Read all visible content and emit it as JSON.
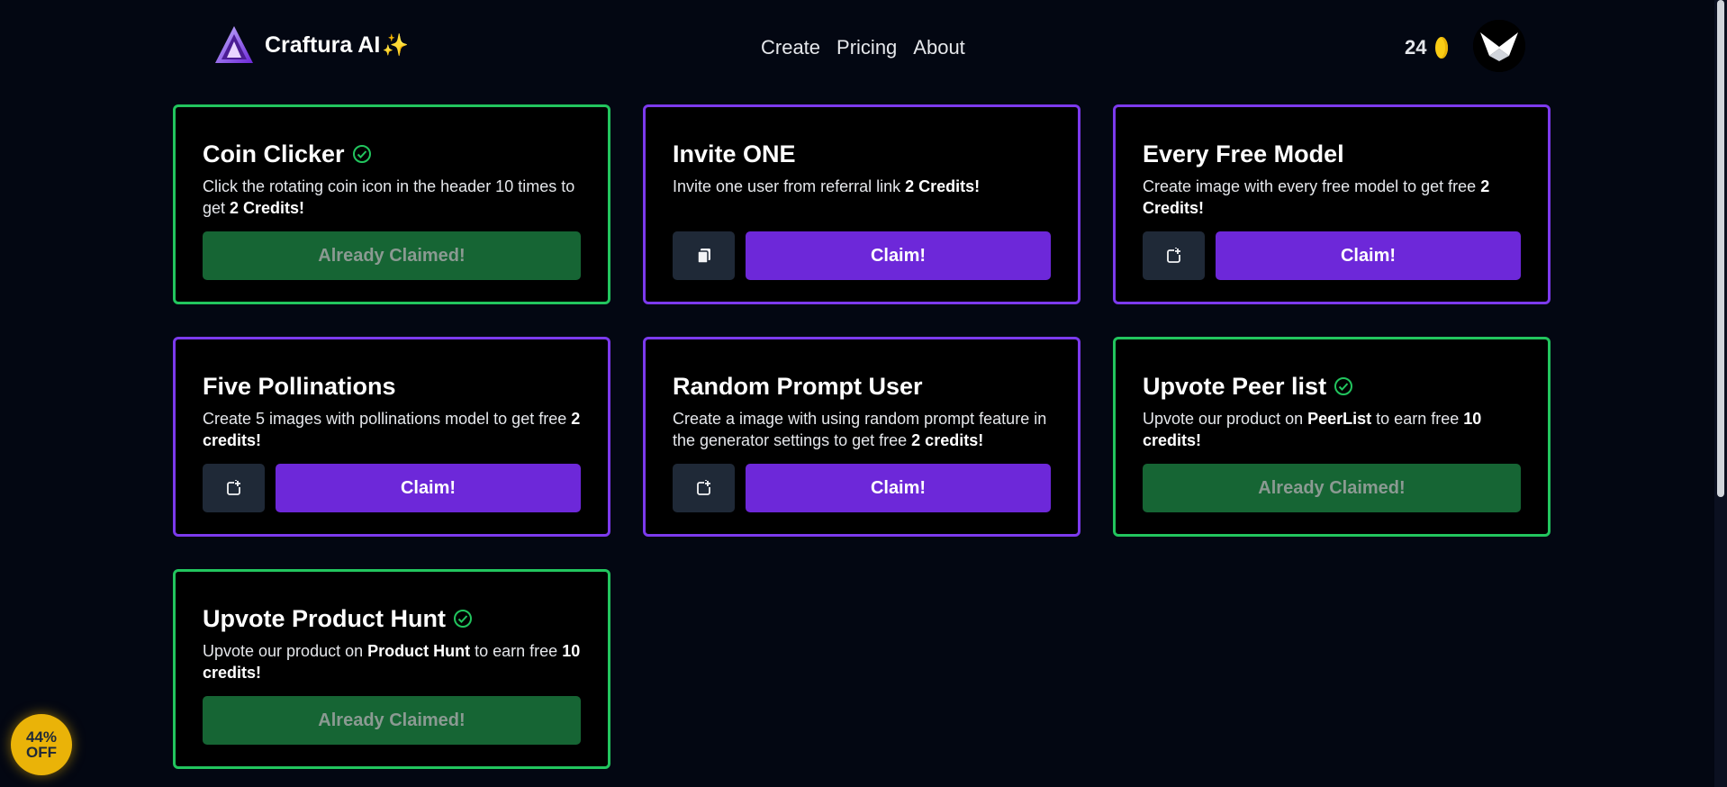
{
  "header": {
    "brand": "Craftura AI",
    "brand_emoji": "✨",
    "nav": [
      "Create",
      "Pricing",
      "About"
    ],
    "credits": "24",
    "colors": {
      "background": "#030712",
      "purple": "#6d28d9",
      "green": "#22c55e",
      "coin": "#facc15"
    }
  },
  "cards": [
    {
      "title": "Coin Clicker",
      "claimed": true,
      "desc_pre": "Click the rotating coin icon in the header 10 times to get ",
      "desc_bold": "2 Credits!",
      "desc_post": "",
      "desc_bold2": "",
      "button": "Already Claimed!",
      "icon": ""
    },
    {
      "title": "Invite ONE",
      "claimed": false,
      "desc_pre": "Invite one user from referral link ",
      "desc_bold": "2 Credits!",
      "desc_post": "",
      "desc_bold2": "",
      "button": "Claim!",
      "icon": "copy-icon"
    },
    {
      "title": "Every Free Model",
      "claimed": false,
      "desc_pre": "Create image with every free model to get free ",
      "desc_bold": "2 Credits!",
      "desc_post": "",
      "desc_bold2": "",
      "button": "Claim!",
      "icon": "open-link-icon"
    },
    {
      "title": "Five Pollinations",
      "claimed": false,
      "desc_pre": "Create 5 images with pollinations model to get free ",
      "desc_bold": "2 credits!",
      "desc_post": "",
      "desc_bold2": "",
      "button": "Claim!",
      "icon": "open-link-icon"
    },
    {
      "title": "Random Prompt User",
      "claimed": false,
      "desc_pre": "Create a image with using random prompt feature in the generator settings to get free ",
      "desc_bold": "2 credits!",
      "desc_post": "",
      "desc_bold2": "",
      "button": "Claim!",
      "icon": "open-link-icon"
    },
    {
      "title": "Upvote Peer list",
      "claimed": true,
      "desc_pre": "Upvote our product on ",
      "desc_bold": "PeerList",
      "desc_post": " to earn free ",
      "desc_bold2": "10 credits!",
      "button": "Already Claimed!",
      "icon": ""
    },
    {
      "title": "Upvote Product Hunt",
      "claimed": true,
      "desc_pre": "Upvote our product on ",
      "desc_bold": "Product Hunt",
      "desc_post": " to earn free ",
      "desc_bold2": "10 credits!",
      "button": "Already Claimed!",
      "icon": ""
    }
  ],
  "discount": {
    "line1": "44%",
    "line2": "OFF"
  }
}
